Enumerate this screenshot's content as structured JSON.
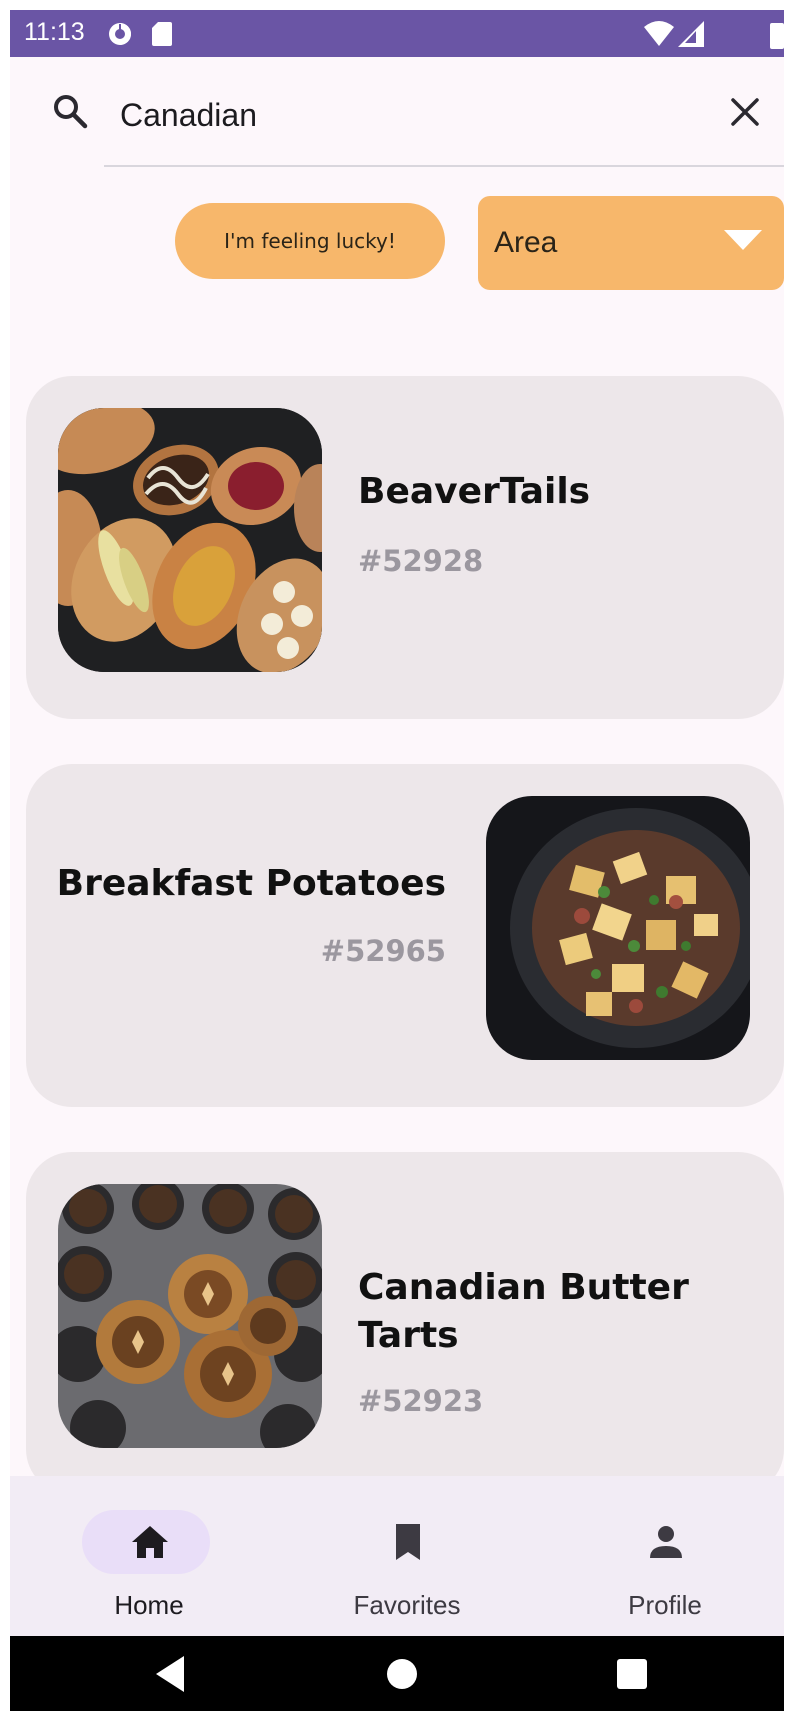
{
  "status_bar": {
    "time": "11:13",
    "left_icons": [
      "data-saver-icon",
      "sd-card-icon"
    ],
    "right_icons": [
      "wifi-icon",
      "signal-icon",
      "battery-icon"
    ],
    "background": "#6a55a5"
  },
  "search": {
    "query": "Canadian",
    "icon": "search-icon",
    "clear_icon": "close-icon"
  },
  "filters": {
    "lucky_label": "I'm feeling lucky!",
    "area_label": "Area",
    "accent": "#f7b76b"
  },
  "meals": [
    {
      "title": "BeaverTails",
      "id": "#52928",
      "image_side": "left"
    },
    {
      "title": "Breakfast Potatoes",
      "id": "#52965",
      "image_side": "right"
    },
    {
      "title": "Canadian Butter Tarts",
      "id": "#52923",
      "image_side": "left"
    }
  ],
  "bottom_nav": {
    "items": [
      {
        "label": "Home",
        "icon": "home-icon",
        "selected": true
      },
      {
        "label": "Favorites",
        "icon": "bookmark-icon",
        "selected": false
      },
      {
        "label": "Profile",
        "icon": "person-icon",
        "selected": false
      }
    ]
  },
  "system_nav": {
    "icons": [
      "back-icon",
      "home-circle-icon",
      "recents-icon"
    ]
  }
}
